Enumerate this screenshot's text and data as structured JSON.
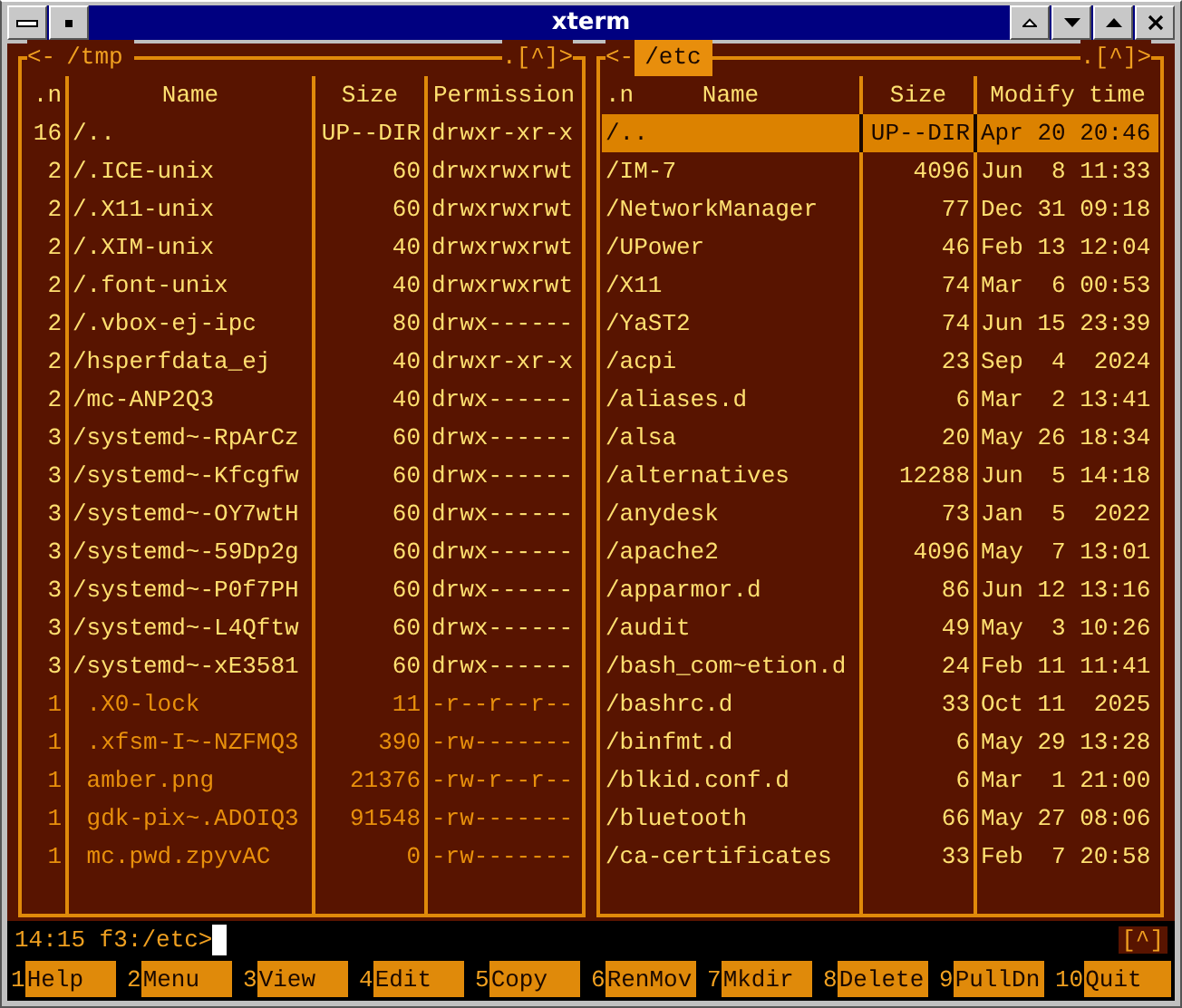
{
  "window": {
    "title": "xterm"
  },
  "panels": [
    {
      "back": "<-",
      "title": "/tmp",
      "hotlist": ".[^]>",
      "active": false,
      "columns": [
        {
          "label": ".n",
          "kind": "number"
        },
        {
          "label": "Name",
          "kind": "text"
        },
        {
          "label": "Size",
          "kind": "number"
        },
        {
          "label": "Permission",
          "kind": "text"
        }
      ],
      "rows": [
        {
          "kind": "dir",
          "selected": false,
          "cells": [
            "16",
            "/..",
            "UP--DIR",
            "drwxr-xr-x"
          ]
        },
        {
          "kind": "dir",
          "selected": false,
          "cells": [
            "2",
            "/.ICE-unix",
            "60",
            "drwxrwxrwt"
          ]
        },
        {
          "kind": "dir",
          "selected": false,
          "cells": [
            "2",
            "/.X11-unix",
            "60",
            "drwxrwxrwt"
          ]
        },
        {
          "kind": "dir",
          "selected": false,
          "cells": [
            "2",
            "/.XIM-unix",
            "40",
            "drwxrwxrwt"
          ]
        },
        {
          "kind": "dir",
          "selected": false,
          "cells": [
            "2",
            "/.font-unix",
            "40",
            "drwxrwxrwt"
          ]
        },
        {
          "kind": "dir",
          "selected": false,
          "cells": [
            "2",
            "/.vbox-ej-ipc",
            "80",
            "drwx------"
          ]
        },
        {
          "kind": "dir",
          "selected": false,
          "cells": [
            "2",
            "/hsperfdata_ej",
            "40",
            "drwxr-xr-x"
          ]
        },
        {
          "kind": "dir",
          "selected": false,
          "cells": [
            "2",
            "/mc-ANP2Q3",
            "40",
            "drwx------"
          ]
        },
        {
          "kind": "dir",
          "selected": false,
          "cells": [
            "3",
            "/systemd~-RpArCz",
            "60",
            "drwx------"
          ]
        },
        {
          "kind": "dir",
          "selected": false,
          "cells": [
            "3",
            "/systemd~-Kfcgfw",
            "60",
            "drwx------"
          ]
        },
        {
          "kind": "dir",
          "selected": false,
          "cells": [
            "3",
            "/systemd~-OY7wtH",
            "60",
            "drwx------"
          ]
        },
        {
          "kind": "dir",
          "selected": false,
          "cells": [
            "3",
            "/systemd~-59Dp2g",
            "60",
            "drwx------"
          ]
        },
        {
          "kind": "dir",
          "selected": false,
          "cells": [
            "3",
            "/systemd~-P0f7PH",
            "60",
            "drwx------"
          ]
        },
        {
          "kind": "dir",
          "selected": false,
          "cells": [
            "3",
            "/systemd~-L4Qftw",
            "60",
            "drwx------"
          ]
        },
        {
          "kind": "dir",
          "selected": false,
          "cells": [
            "3",
            "/systemd~-xE3581",
            "60",
            "drwx------"
          ]
        },
        {
          "kind": "file",
          "selected": false,
          "cells": [
            "1",
            " .X0-lock",
            "11",
            "-r--r--r--"
          ]
        },
        {
          "kind": "file",
          "selected": false,
          "cells": [
            "1",
            " .xfsm-I~-NZFMQ3",
            "390",
            "-rw-------"
          ]
        },
        {
          "kind": "file",
          "selected": false,
          "cells": [
            "1",
            " amber.png",
            "21376",
            "-rw-r--r--"
          ]
        },
        {
          "kind": "file",
          "selected": false,
          "cells": [
            "1",
            " gdk-pix~.ADOIQ3",
            "91548",
            "-rw-------"
          ]
        },
        {
          "kind": "file",
          "selected": false,
          "cells": [
            "1",
            " mc.pwd.zpyvAC",
            "0",
            "-rw-------"
          ]
        }
      ]
    },
    {
      "back": "<-",
      "title": "/etc",
      "hotlist": ".[^]>",
      "active": true,
      "columns": [
        {
          "label": "Name",
          "kind": "text",
          "sort_mark": ".n"
        },
        {
          "label": "Size",
          "kind": "number"
        },
        {
          "label": "Modify time",
          "kind": "text"
        }
      ],
      "rows": [
        {
          "kind": "dir",
          "selected": true,
          "cells": [
            "/..",
            "UP--DIR",
            "Apr 20 20:46"
          ]
        },
        {
          "kind": "dir",
          "selected": false,
          "cells": [
            "/IM-7",
            "4096",
            "Jun  8 11:33"
          ]
        },
        {
          "kind": "dir",
          "selected": false,
          "cells": [
            "/NetworkManager",
            "77",
            "Dec 31 09:18"
          ]
        },
        {
          "kind": "dir",
          "selected": false,
          "cells": [
            "/UPower",
            "46",
            "Feb 13 12:04"
          ]
        },
        {
          "kind": "dir",
          "selected": false,
          "cells": [
            "/X11",
            "74",
            "Mar  6 00:53"
          ]
        },
        {
          "kind": "dir",
          "selected": false,
          "cells": [
            "/YaST2",
            "74",
            "Jun 15 23:39"
          ]
        },
        {
          "kind": "dir",
          "selected": false,
          "cells": [
            "/acpi",
            "23",
            "Sep  4  2024"
          ]
        },
        {
          "kind": "dir",
          "selected": false,
          "cells": [
            "/aliases.d",
            "6",
            "Mar  2 13:41"
          ]
        },
        {
          "kind": "dir",
          "selected": false,
          "cells": [
            "/alsa",
            "20",
            "May 26 18:34"
          ]
        },
        {
          "kind": "dir",
          "selected": false,
          "cells": [
            "/alternatives",
            "12288",
            "Jun  5 14:18"
          ]
        },
        {
          "kind": "dir",
          "selected": false,
          "cells": [
            "/anydesk",
            "73",
            "Jan  5  2022"
          ]
        },
        {
          "kind": "dir",
          "selected": false,
          "cells": [
            "/apache2",
            "4096",
            "May  7 13:01"
          ]
        },
        {
          "kind": "dir",
          "selected": false,
          "cells": [
            "/apparmor.d",
            "86",
            "Jun 12 13:16"
          ]
        },
        {
          "kind": "dir",
          "selected": false,
          "cells": [
            "/audit",
            "49",
            "May  3 10:26"
          ]
        },
        {
          "kind": "dir",
          "selected": false,
          "cells": [
            "/bash_com~etion.d",
            "24",
            "Feb 11 11:41"
          ]
        },
        {
          "kind": "dir",
          "selected": false,
          "cells": [
            "/bashrc.d",
            "33",
            "Oct 11  2025"
          ]
        },
        {
          "kind": "dir",
          "selected": false,
          "cells": [
            "/binfmt.d",
            "6",
            "May 29 13:28"
          ]
        },
        {
          "kind": "dir",
          "selected": false,
          "cells": [
            "/blkid.conf.d",
            "6",
            "Mar  1 21:00"
          ]
        },
        {
          "kind": "dir",
          "selected": false,
          "cells": [
            "/bluetooth",
            "66",
            "May 27 08:06"
          ]
        },
        {
          "kind": "dir",
          "selected": false,
          "cells": [
            "/ca-certificates",
            "33",
            "Feb  7 20:58"
          ]
        }
      ]
    }
  ],
  "command_line": {
    "prompt": "14:15 f3:/etc>",
    "hotlist": "[^]"
  },
  "function_keys": [
    {
      "number": "1",
      "label": "Help"
    },
    {
      "number": "2",
      "label": "Menu"
    },
    {
      "number": "3",
      "label": "View"
    },
    {
      "number": "4",
      "label": "Edit"
    },
    {
      "number": "5",
      "label": "Copy"
    },
    {
      "number": "6",
      "label": "RenMov"
    },
    {
      "number": "7",
      "label": "Mkdir"
    },
    {
      "number": "8",
      "label": "Delete"
    },
    {
      "number": "9",
      "label": "PullDn"
    },
    {
      "number": "10",
      "label": "Quit"
    }
  ]
}
